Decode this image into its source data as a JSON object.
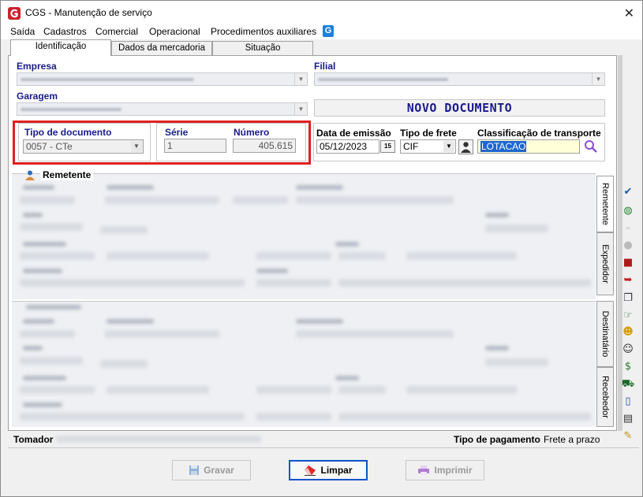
{
  "window": {
    "title": "CGS - Manutenção de serviço"
  },
  "menu": [
    "Saída",
    "Cadastros",
    "Comercial",
    "Operacional",
    "Procedimentos auxiliares"
  ],
  "tabs": [
    "Identificação",
    "Dados da mercadoria",
    "Situação"
  ],
  "labels": {
    "empresa": "Empresa",
    "filial": "Filial",
    "garagem": "Garagem",
    "tipo_documento": "Tipo de documento",
    "serie": "Série",
    "numero": "Número",
    "data_emissao": "Data de emissão",
    "tipo_frete": "Tipo de frete",
    "classificacao": "Classificação de transporte"
  },
  "status_banner": "NOVO DOCUMENTO",
  "fields": {
    "tipo_documento": "0057 - CTe",
    "serie": "1",
    "numero": "405.615",
    "data_emissao": "05/12/2023",
    "calendar_btn": "15",
    "tipo_frete": "CIF",
    "classificacao": "LOTACAO"
  },
  "sections": {
    "remetente": "Remetente"
  },
  "side_tabs": [
    "Remetente",
    "Expedidor",
    "Destinatário",
    "Recebedor"
  ],
  "footer": {
    "tomador_label": "Tomador",
    "tipo_pagamento_label": "Tipo de pagamento",
    "tipo_pagamento_value": "Frete a prazo"
  },
  "buttons": {
    "gravar": "Gravar",
    "limpar": "Limpar",
    "imprimir": "Imprimir"
  },
  "icons": {
    "app": "cgs-logo-icon",
    "calendar": "calendar-icon",
    "user": "person-icon",
    "search": "search-icon",
    "save": "floppy-disk-icon",
    "eraser": "eraser-icon",
    "print": "printer-icon"
  },
  "colors": {
    "label_blue": "#1a1a8c",
    "highlight_red": "#e02020",
    "selection_blue": "#1e66d0"
  }
}
